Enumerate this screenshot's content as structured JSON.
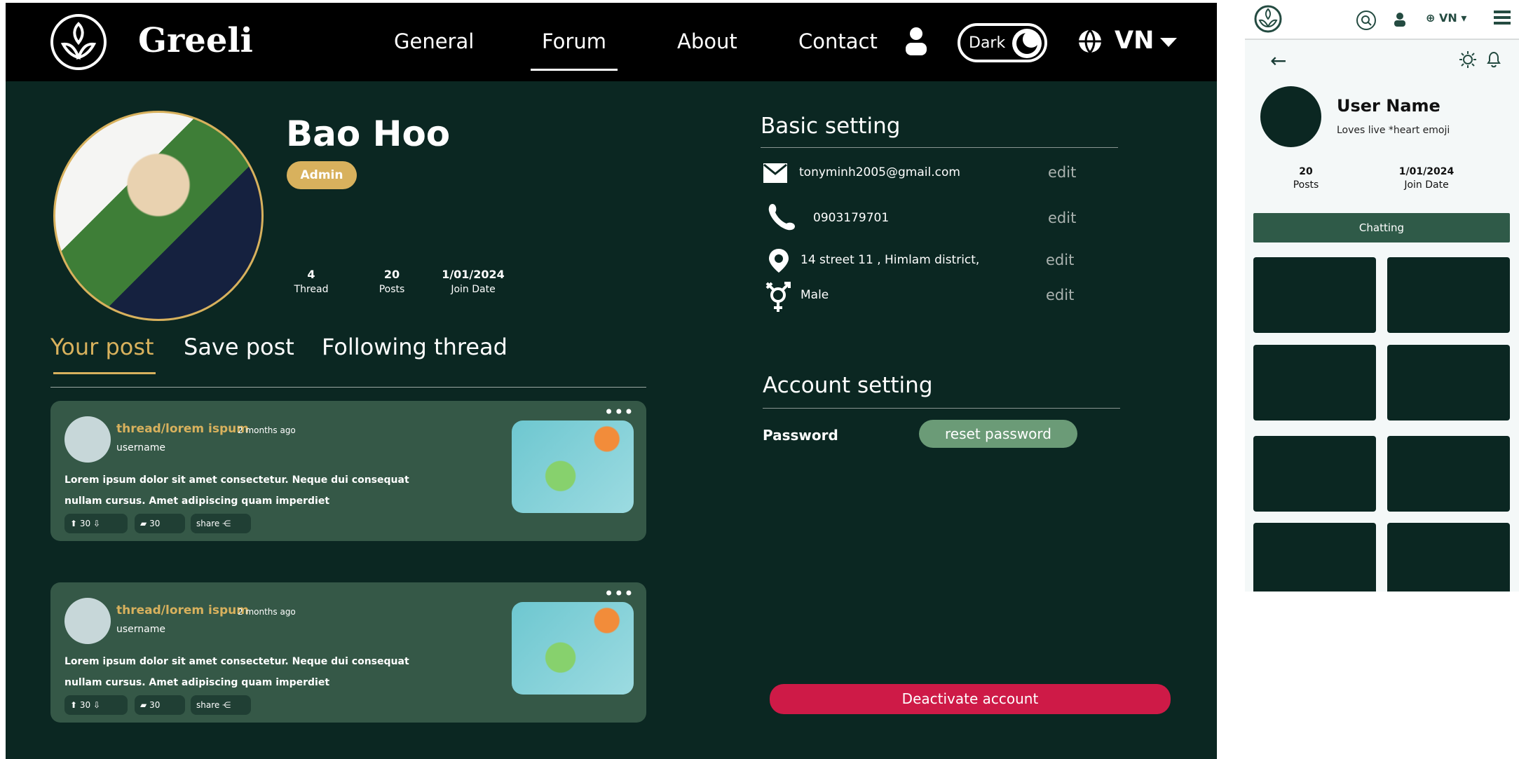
{
  "desktop": {
    "brand": "Greeli",
    "nav": [
      "General",
      "Forum",
      "About",
      "Contact"
    ],
    "theme": "Dark",
    "language": "VN",
    "profile": {
      "name": "Bao Hoo",
      "role": "Admin",
      "stats": [
        {
          "value": "4",
          "label": "Thread"
        },
        {
          "value": "20",
          "label": "Posts"
        },
        {
          "value": "1/01/2024",
          "label": "Join Date"
        }
      ]
    },
    "tabs": [
      "Your post",
      "Save post",
      "Following thread"
    ],
    "posts": [
      {
        "title": "thread/lorem ispum",
        "time": "2 months ago",
        "username": "username",
        "text": "Lorem ipsum dolor sit amet consectetur. Neque dui consequat nullam cursus. Amet adipiscing quam imperdiet",
        "votes": "30",
        "comments": "30",
        "share": "share"
      },
      {
        "title": "thread/lorem ispum",
        "time": "2 months ago",
        "username": "username",
        "text": "Lorem ipsum dolor sit amet consectetur. Neque dui consequat nullam cursus. Amet adipiscing quam imperdiet",
        "votes": "30",
        "comments": "30",
        "share": "share"
      }
    ],
    "basic_setting": {
      "title": "Basic setting",
      "email": "tonyminh2005@gmail.com",
      "phone": "0903179701",
      "address": "14 street 11 , Himlam district,",
      "gender": "Male",
      "edit": "edit"
    },
    "account_setting": {
      "title": "Account setting",
      "password_label": "Password",
      "reset_button": "reset password"
    },
    "deactivate_button": "Deactivate account"
  },
  "mobile": {
    "language": "VN",
    "user_name": "User Name",
    "bio": "Loves live *heart emoji",
    "stats": [
      {
        "value": "20",
        "label": "Posts"
      },
      {
        "value": "1/01/2024",
        "label": "Join Date"
      }
    ],
    "chat_button": "Chatting"
  },
  "colors": {
    "background": "#0b2722",
    "accent_gold": "#d8b15d",
    "card_green": "#355847",
    "danger": "#ce1a47"
  },
  "icons": [
    "logo-icon",
    "user-icon",
    "moon-icon",
    "globe-icon",
    "chevron-down-icon",
    "mail-icon",
    "phone-icon",
    "location-icon",
    "gender-icon",
    "upvote-icon",
    "downvote-icon",
    "comment-icon",
    "share-icon",
    "more-icon",
    "search-icon",
    "menu-icon",
    "back-icon",
    "gear-icon",
    "bell-icon"
  ]
}
